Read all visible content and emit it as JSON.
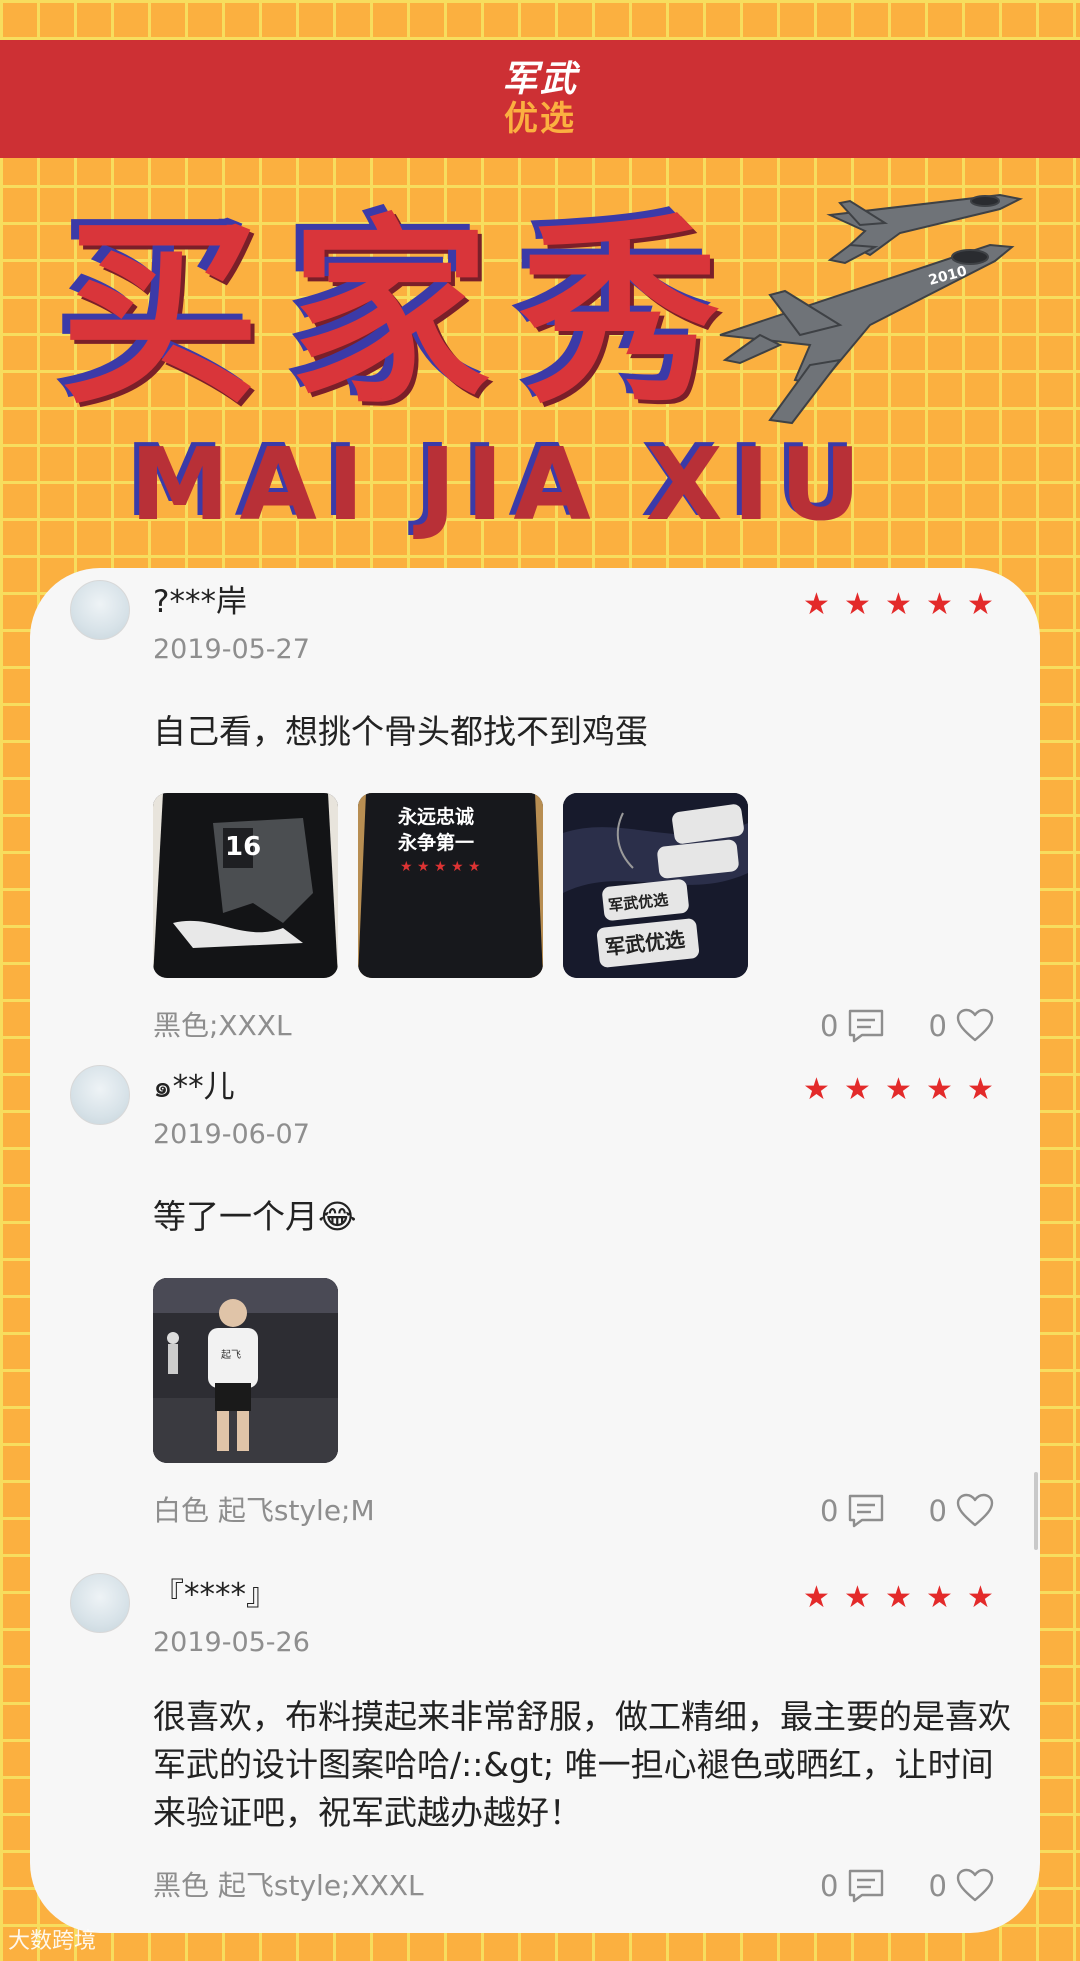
{
  "header": {
    "logo_top": "军武",
    "logo_bottom": "优选"
  },
  "title": {
    "chinese": "买家秀",
    "pinyin": "MAI JIA XIU"
  },
  "colors": {
    "background": "#fbb040",
    "header": "#cd3034",
    "star": "#e32a2a"
  },
  "reviews": [
    {
      "user": "?***岸",
      "date": "2019-05-27",
      "rating": 5,
      "text": "自己看，想挑个骨头都找不到鸡蛋",
      "photos": [
        {
          "label": "16",
          "caption": ""
        },
        {
          "label": "永远忠诚",
          "caption": "永争第一"
        },
        {
          "label": "军武优选",
          "caption": "军武优选"
        }
      ],
      "spec": "黑色;XXXL",
      "comments": "0",
      "likes": "0"
    },
    {
      "user": "๑**儿",
      "date": "2019-06-07",
      "rating": 5,
      "text": "等了一个月😂",
      "photos": [
        {
          "label": "起飞",
          "caption": ""
        }
      ],
      "spec": "白色 起飞style;M",
      "comments": "0",
      "likes": "0"
    },
    {
      "user": "『****』",
      "date": "2019-05-26",
      "rating": 5,
      "text": "很喜欢，布料摸起来非常舒服，做工精细，最主要的是喜欢军武的设计图案哈哈/::&gt; 唯一担心褪色或晒红，让时间来验证吧，祝军武越办越好！",
      "photos": [],
      "spec": "黑色 起飞style;XXXL",
      "comments": "0",
      "likes": "0"
    }
  ],
  "watermark": "大数跨境"
}
